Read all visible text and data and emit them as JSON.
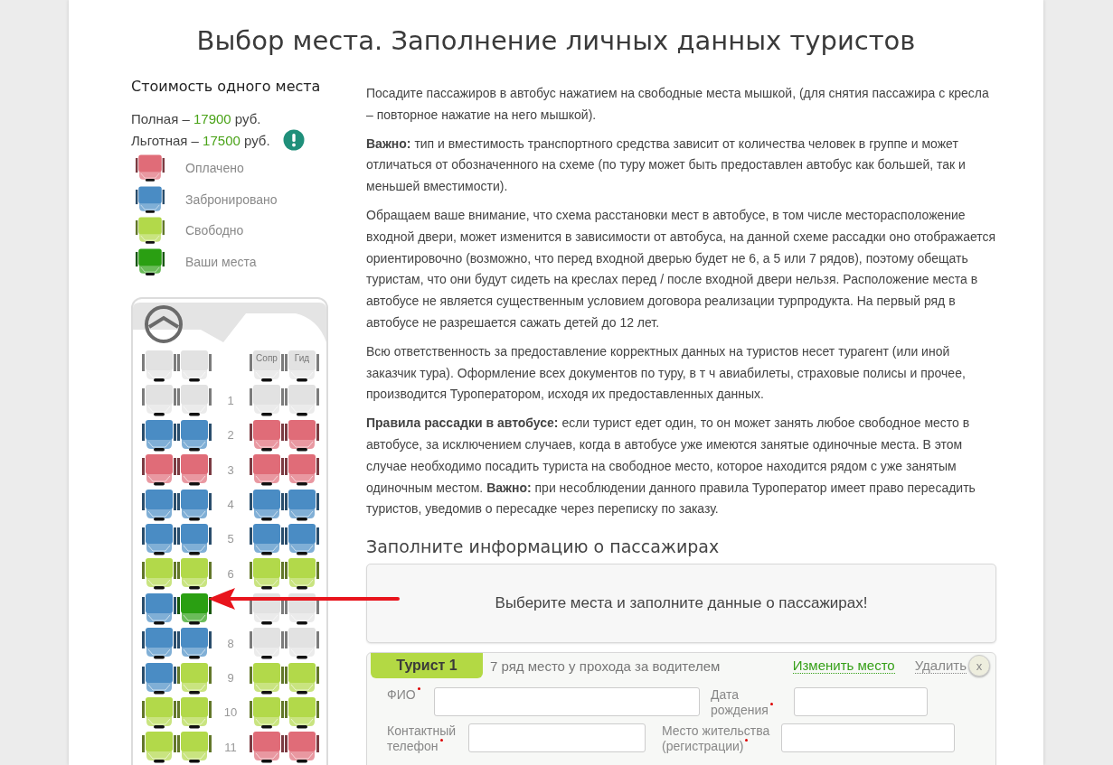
{
  "title": "Выбор места. Заполнение личных данных туристов",
  "price": {
    "heading": "Стоимость одного места",
    "lines": [
      {
        "label": "Полная –",
        "amount": "17900",
        "unit": "руб.",
        "info": false
      },
      {
        "label": "Льготная –",
        "amount": "17500",
        "unit": "руб.",
        "info": true
      }
    ]
  },
  "legend": [
    {
      "color": "#e06c78",
      "label": "Оплачено"
    },
    {
      "color": "#4a8cc4",
      "label": "Забронировано"
    },
    {
      "color": "#b2d94a",
      "label": "Свободно"
    },
    {
      "color": "#2a9f12",
      "label": "Ваши места"
    }
  ],
  "bus": {
    "rows": [
      {
        "seats": [
          {
            "color": "#e2e2e2"
          },
          {
            "color": "#e2e2e2"
          },
          {
            "color": "#e2e2e2",
            "label": "Сопр"
          },
          {
            "color": "#e2e2e2",
            "label": "Гид"
          }
        ]
      },
      {
        "number": "1",
        "seats": [
          {
            "color": "#e2e2e2"
          },
          {
            "color": "#e2e2e2"
          },
          {
            "color": "#e2e2e2"
          },
          {
            "color": "#e2e2e2"
          }
        ]
      },
      {
        "number": "2",
        "seats": [
          {
            "color": "#4a8cc4"
          },
          {
            "color": "#4a8cc4"
          },
          {
            "color": "#e06c78"
          },
          {
            "color": "#e06c78"
          }
        ]
      },
      {
        "number": "3",
        "seats": [
          {
            "color": "#e06c78"
          },
          {
            "color": "#e06c78"
          },
          {
            "color": "#e06c78"
          },
          {
            "color": "#e06c78"
          }
        ]
      },
      {
        "number": "4",
        "seats": [
          {
            "color": "#4a8cc4"
          },
          {
            "color": "#4a8cc4"
          },
          {
            "color": "#4a8cc4"
          },
          {
            "color": "#4a8cc4"
          }
        ]
      },
      {
        "number": "5",
        "seats": [
          {
            "color": "#4a8cc4"
          },
          {
            "color": "#4a8cc4"
          },
          {
            "color": "#4a8cc4"
          },
          {
            "color": "#4a8cc4"
          }
        ]
      },
      {
        "number": "6",
        "seats": [
          {
            "color": "#b2d94a"
          },
          {
            "color": "#b2d94a"
          },
          {
            "color": "#b2d94a"
          },
          {
            "color": "#b2d94a"
          }
        ]
      },
      {
        "seats": [
          {
            "color": "#4a8cc4"
          },
          {
            "color": "#2a9f12"
          },
          {
            "color": "#e2e2e2"
          },
          {
            "color": "#e2e2e2"
          }
        ]
      },
      {
        "number": "8",
        "seats": [
          {
            "color": "#4a8cc4"
          },
          {
            "color": "#4a8cc4"
          },
          {
            "color": "#e2e2e2"
          },
          {
            "color": "#e2e2e2"
          }
        ]
      },
      {
        "number": "9",
        "seats": [
          {
            "color": "#4a8cc4"
          },
          {
            "color": "#b2d94a"
          },
          {
            "color": "#b2d94a"
          },
          {
            "color": "#b2d94a"
          }
        ]
      },
      {
        "number": "10",
        "seats": [
          {
            "color": "#b2d94a"
          },
          {
            "color": "#b2d94a"
          },
          {
            "color": "#b2d94a"
          },
          {
            "color": "#b2d94a"
          }
        ]
      },
      {
        "number": "11",
        "seats": [
          {
            "color": "#b2d94a"
          },
          {
            "color": "#b2d94a"
          },
          {
            "color": "#e06c78"
          },
          {
            "color": "#e06c78"
          }
        ]
      }
    ]
  },
  "paragraphs": [
    "Посадите пассажиров в автобус нажатием на свободные места мышкой, (для снятия пассажира с кресла – повторное нажатие на него мышкой).",
    "**Важно:** тип и вместимость транспортного средства зависит от количества человек в группе и может отличаться от обозначенного на схеме (по туру может быть предоставлен автобус как большей, так и меньшей вместимости).",
    "Обращаем ваше внимание, что схема расстановки мест в автобусе, в том числе месторасположение входной двери, может изменится в зависимости от автобуса, на данной схеме рассадки оно отображается ориентировочно (возможно, что перед входной дверью будет не 6, а 5 или 7 рядов), поэтому обещать туристам, что они будут сидеть на креслах перед / после входной двери нельзя. Расположение места в автобусе не является существенным условием договора реализации турпродукта. На первый ряд в автобусе не разрешается сажать детей до 12 лет.",
    "Всю ответственность за предоставление корректных данных на туристов несет турагент (или иной заказчик тура). Оформление всех документов по туру, в т ч авиабилеты, страховые полисы и прочее, производится Туроператором, исходя их предоставленных данных.",
    "**Правила рассадки в автобусе:** если турист едет один, то он может занять любое свободное место в автобусе, за исключением случаев, когда в автобусе уже имеются занятые одиночные места. В этом случае необходимо посадить туриста на свободное место, которое находится рядом с уже занятым одиночным местом. **Важно:** при несоблюдении данного правила Туроператор имеет право пересадить туристов, уведомив о пересадке через переписку по заказу."
  ],
  "passengers": {
    "heading": "Заполните информацию о пассажирах",
    "notice": "Выберите места и заполните данные о пассажирах!",
    "tourists": [
      {
        "tab": "Турист 1",
        "seat": "7 ряд место у прохода за водителем",
        "change": "Изменить место",
        "remove": "Удалить",
        "close": "x",
        "fields": [
          {
            "label": "ФИО",
            "kind": "wide"
          },
          {
            "label": "Дата рождения",
            "kind": "short"
          },
          {
            "label": "Контактный телефон",
            "kind": "medium"
          },
          {
            "label": "Место жительства (регистрации)",
            "kind": "medium"
          }
        ]
      }
    ]
  }
}
